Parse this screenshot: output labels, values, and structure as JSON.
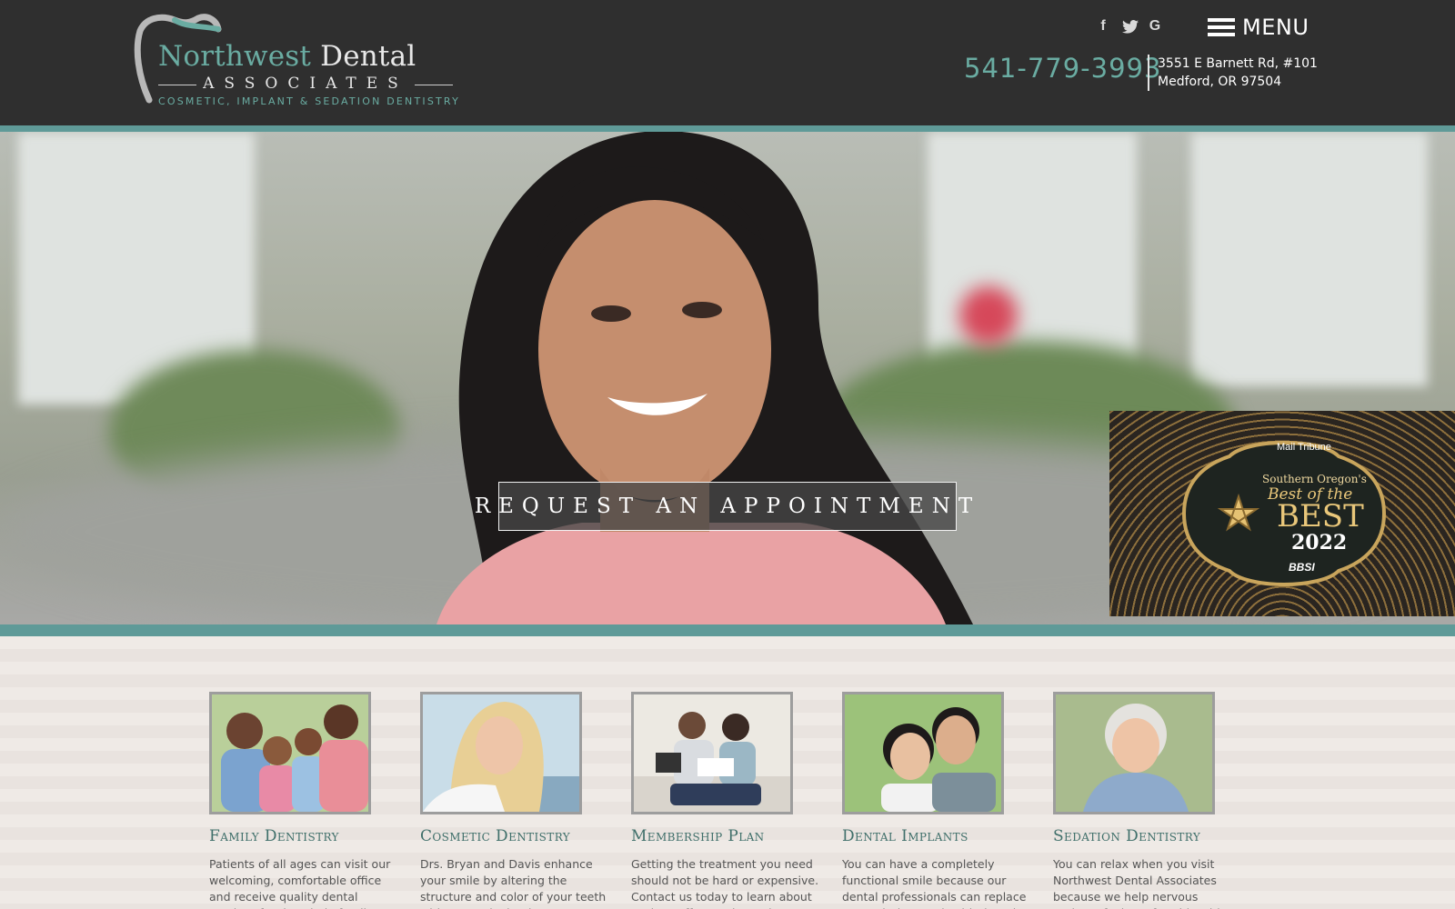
{
  "header": {
    "logo": {
      "name_first": "Northwest",
      "name_second": "Dental",
      "subtitle": "ASSOCIATES",
      "tagline": "COSMETIC, IMPLANT & SEDATION DENTISTRY"
    },
    "social": [
      {
        "name": "facebook",
        "glyph": "f"
      },
      {
        "name": "twitter",
        "glyph": "🐦"
      },
      {
        "name": "google",
        "glyph": "G"
      }
    ],
    "menu_label": "MENU",
    "phone": "541-779-3993",
    "address_line1": "3551 E Barnett Rd, #101",
    "address_line2": "Medford, OR 97504"
  },
  "hero": {
    "cta_label": "REQUEST AN APPOINTMENT",
    "award": {
      "presented": "Mail Tribune",
      "region": "Southern Oregon's",
      "best_of": "Best of the",
      "best": "BEST",
      "year": "2022",
      "partner": "BBSI"
    }
  },
  "services": [
    {
      "title": "Family Dentistry",
      "text": "Patients of all ages can visit our welcoming, comfortable office and receive quality dental services for the whole family."
    },
    {
      "title": "Cosmetic Dentistry",
      "text": "Drs. Bryan and Davis enhance your smile by altering the structure and color of your teeth with cosmetic dentistry."
    },
    {
      "title": "Membership Plan",
      "text": "Getting the treatment you need should not be hard or expensive. Contact us today to learn about savings offers and our plan details."
    },
    {
      "title": "Dental Implants",
      "text": "You can have a completely functional smile because our dental professionals can replace your missing teeth with dental implants."
    },
    {
      "title": "Sedation Dentistry",
      "text": "You can relax when you visit Northwest Dental Associates because we help nervous patients feel comfortable with IV sedation."
    }
  ],
  "colors": {
    "header_bg": "#2f2f2f",
    "accent_teal": "#5f9a98",
    "logo_teal": "#6aaca2",
    "service_title": "#3f6f6a"
  }
}
